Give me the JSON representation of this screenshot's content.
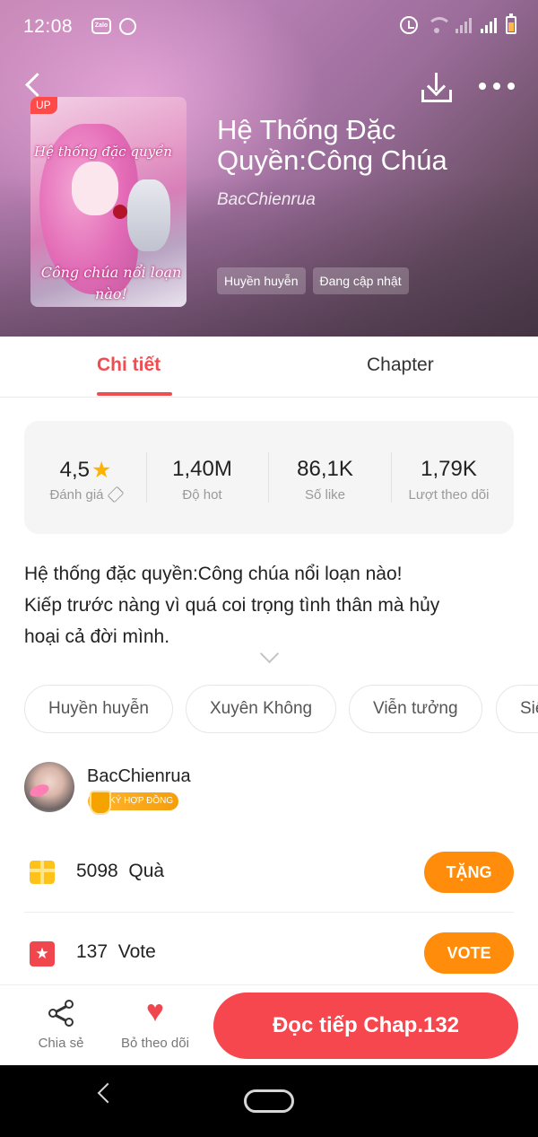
{
  "status_bar": {
    "time": "12:08",
    "app_icons": [
      "zalo-icon",
      "chat-icon"
    ],
    "system_icons": [
      "alarm-icon",
      "wifi-icon",
      "signal-icon",
      "signal-icon",
      "battery-icon"
    ],
    "zalo_label": "Zalo"
  },
  "header": {
    "back_icon": "chevron-left-icon",
    "download_icon": "download-icon",
    "more_icon": "more-dots-icon"
  },
  "book": {
    "title": "Hệ Thống Đặc Quyền:Công Chúa",
    "author": "BacChienrua",
    "tags": [
      "Huyền huyễn",
      "Đang cập nhật"
    ],
    "cover": {
      "badge": "UP",
      "text_top": "Hệ thống đặc quyền",
      "text_bottom": "Công chúa nổi loạn nào!"
    }
  },
  "tabs": {
    "detail": "Chi tiết",
    "chapter": "Chapter",
    "active": "detail"
  },
  "stats": [
    {
      "value": "4,5",
      "label": "Đánh giá",
      "icon": "star-icon",
      "label_icon": "pencil-icon"
    },
    {
      "value": "1,40M",
      "label": "Độ hot"
    },
    {
      "value": "86,1K",
      "label": "Số like"
    },
    {
      "value": "1,79K",
      "label": "Lượt theo dõi"
    }
  ],
  "description": {
    "line1": "Hệ thống đặc quyền:Công chúa nổi loạn nào!",
    "line2": "Kiếp trước nàng vì quá coi trọng tình thân mà hủy",
    "line3": "hoại cả đời mình."
  },
  "genres": [
    "Huyền huyễn",
    "Xuyên Không",
    "Viễn tưởng",
    "Siê"
  ],
  "author_card": {
    "name": "BacChienrua",
    "badge": "KÝ HỢP ĐỒNG"
  },
  "gift": {
    "count": "5098",
    "label": "Quà",
    "button": "TẶNG"
  },
  "vote": {
    "count": "137",
    "label": "Vote",
    "button": "VOTE"
  },
  "bottom_bar": {
    "share_label": "Chia sẻ",
    "follow_label": "Bỏ theo dõi",
    "read_button": "Đọc tiếp Chap.132"
  },
  "colors": {
    "accent_red": "#ef4d52",
    "button_orange": "#ff8c0a",
    "read_button": "#f6474e",
    "star": "#ffb300"
  }
}
